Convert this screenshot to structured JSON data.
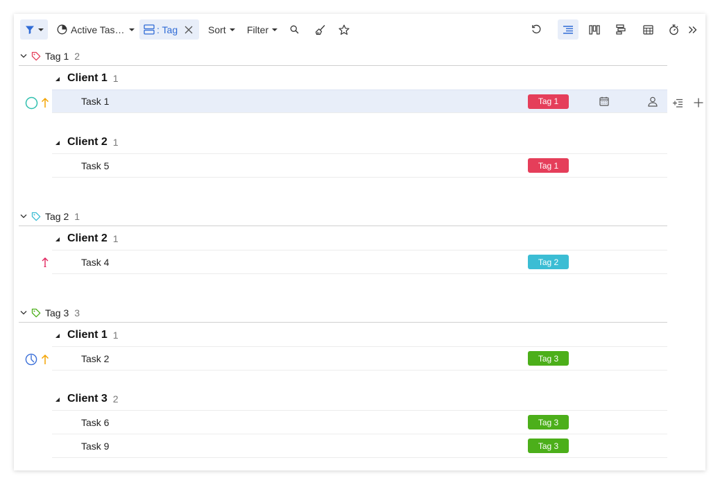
{
  "toolbar": {
    "view_label": "Active Tas…",
    "group_chip_label": ": Tag",
    "sort_label": "Sort",
    "filter_label": "Filter"
  },
  "colors": {
    "accent": "#2f6bd6",
    "tag1": "#e53e5a",
    "tag2": "#3bbdd4",
    "tag3": "#4caf1a",
    "priority_high": "#f4a300",
    "priority_urgent": "#e0245e"
  },
  "groups": [
    {
      "label": "Tag 1",
      "count": "2",
      "subgroups": [
        {
          "label": "Client 1",
          "count": "1",
          "tasks": [
            {
              "name": "Task 1",
              "tag": "Tag 1"
            }
          ]
        },
        {
          "label": "Client 2",
          "count": "1",
          "tasks": [
            {
              "name": "Task 5",
              "tag": "Tag 1"
            }
          ]
        }
      ]
    },
    {
      "label": "Tag 2",
      "count": "1",
      "subgroups": [
        {
          "label": "Client 2",
          "count": "1",
          "tasks": [
            {
              "name": "Task 4",
              "tag": "Tag 2"
            }
          ]
        }
      ]
    },
    {
      "label": "Tag 3",
      "count": "3",
      "subgroups": [
        {
          "label": "Client 1",
          "count": "1",
          "tasks": [
            {
              "name": "Task 2",
              "tag": "Tag 3"
            }
          ]
        },
        {
          "label": "Client 3",
          "count": "2",
          "tasks": [
            {
              "name": "Task 6",
              "tag": "Tag 3"
            },
            {
              "name": "Task 9",
              "tag": "Tag 3"
            }
          ]
        }
      ]
    }
  ]
}
